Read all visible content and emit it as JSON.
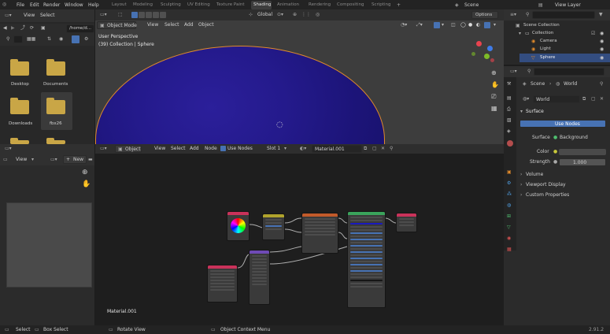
{
  "topbar": {
    "menus": [
      "File",
      "Edit",
      "Render",
      "Window",
      "Help"
    ],
    "workspaces": [
      "Layout",
      "Modeling",
      "Sculpting",
      "UV Editing",
      "Texture Paint",
      "Shading",
      "Animation",
      "Rendering",
      "Compositing",
      "Scripting"
    ],
    "active_workspace": "Shading",
    "scene_label": "Scene",
    "view_layer_label": "View Layer"
  },
  "filebrowser": {
    "menus": [
      "View",
      "Select"
    ],
    "path": "/home/d...",
    "folders": [
      "Desktop",
      "Documents",
      "Downloads",
      "fbx26"
    ]
  },
  "imageeditor": {
    "view": "View",
    "new_button": "New"
  },
  "viewport": {
    "mode": "Object Mode",
    "menus": [
      "View",
      "Select",
      "Add",
      "Object"
    ],
    "transform": "Global",
    "options": "Options",
    "overlay_line1": "User Perspective",
    "overlay_line2": "(39) Collection | Sphere",
    "colors": {
      "sphere": "#1c1478",
      "outline": "#e08a2b"
    }
  },
  "nodeeditor": {
    "mode": "Object",
    "menus": [
      "View",
      "Select",
      "Add",
      "Node"
    ],
    "use_nodes": "Use Nodes",
    "slot": "Slot 1",
    "material": "Material.001",
    "footer_label": "Material.001"
  },
  "outliner": {
    "items": [
      {
        "label": "Scene Collection"
      },
      {
        "label": "Collection"
      },
      {
        "label": "Camera"
      },
      {
        "label": "Light"
      },
      {
        "label": "Sphere"
      }
    ]
  },
  "properties": {
    "tabs": [
      "Scene",
      "World"
    ],
    "world_name": "World",
    "surface_title": "Surface",
    "use_nodes_button": "Use Nodes",
    "surface_label": "Surface",
    "surface_value": "Background",
    "color_label": "Color",
    "strength_label": "Strength",
    "strength_value": "1.000",
    "collapsed": [
      "Volume",
      "Viewport Display",
      "Custom Properties"
    ]
  },
  "statusbar": {
    "select": "Select",
    "box_select": "Box Select",
    "rotate_view": "Rotate View",
    "context_menu": "Object Context Menu",
    "version": "2.91.2"
  }
}
